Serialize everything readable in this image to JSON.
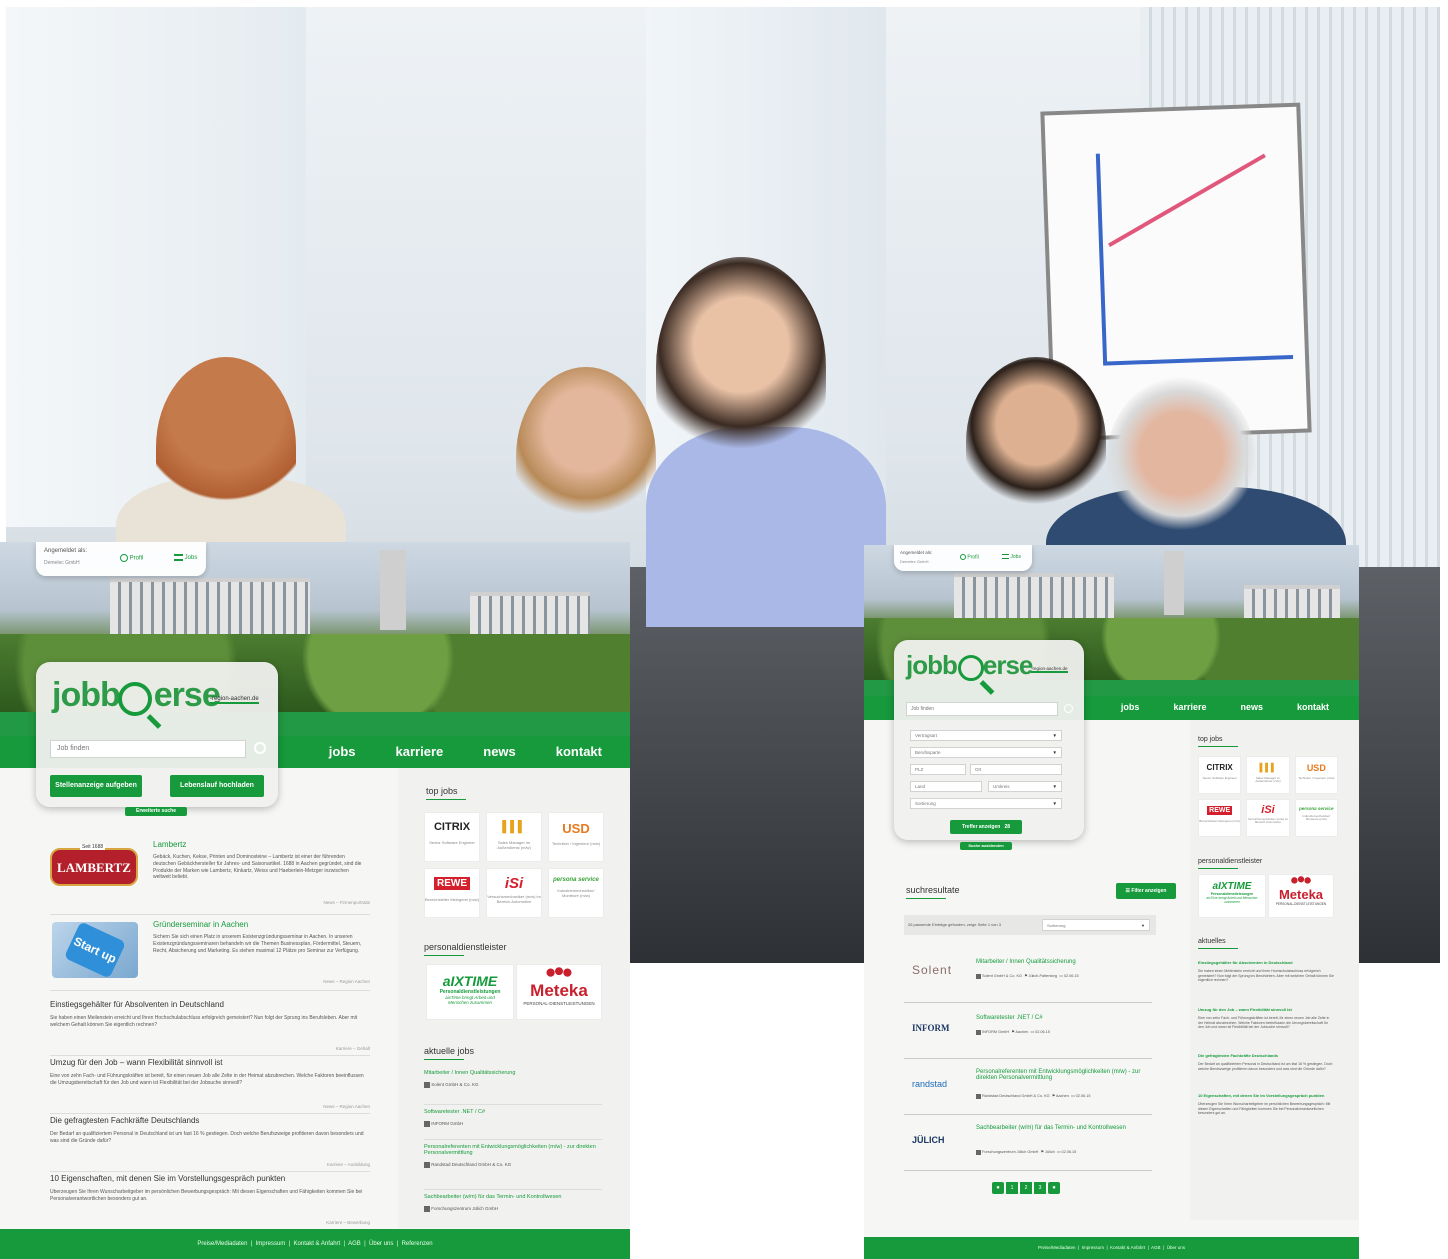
{
  "left": {
    "login": {
      "label": "Angemeldet als:",
      "company": "Demelec GmbH",
      "profil": "Profil",
      "jobs": "Jobs"
    },
    "logo": {
      "word": "jobb",
      "word2": "erse",
      "domain": "-region-aachen.de"
    },
    "search_placeholder": "Job finden",
    "nav": [
      "jobs",
      "karriere",
      "news",
      "kontakt"
    ],
    "buttons": {
      "post": "Stellenanzeige aufgeben",
      "cv": "Lebenslauf hochladen",
      "advanced": "Erweiterte suche"
    },
    "articles": [
      {
        "title": "Lambertz",
        "text": "Gebäck, Kuchen, Kekse, Printen und Dominosteine – Lambertz ist einer der führenden deutschen Gebäckhersteller für Jahres- und Saisonartikel. 1688 in Aachen gegründet, sind die Produkte der Marken wie Lambertz, Kinkartz, Weiss und Haeberlein-Metzger inzwischen weltweit beliebt.",
        "tag": "News – Firmenportraits",
        "logo": "LAMBERTZ",
        "logo_sub": "Seit 1688"
      },
      {
        "title": "Gründerseminar in Aachen",
        "text": "Sichern Sie sich einen Platz in unserem Existenzgründungsseminar in Aachen. In unseren Existenzgründungsseminaren behandeln wir die Themen Businessplan, Fördermittel, Steuern, Recht, Absicherung und Marketing. Es stehen maximal 12 Plätze pro Seminar zur Verfügung.",
        "tag": "News – Region Aachen",
        "logo": "Start up"
      }
    ],
    "news": [
      {
        "title": "Einstiegsgehälter für Absolventen in Deutschland",
        "text": "Sie haben einen Meilenstein erreicht und Ihren Hochschulabschluss erfolgreich gemeistert? Nun folgt der Sprung ins Berufsleben. Aber mit welchem Gehalt können Sie eigentlich rechnen?",
        "tag": "Karriere – Gehalt"
      },
      {
        "title": "Umzug für den Job – wann Flexibilität sinnvoll ist",
        "text": "Eine von zehn Fach- und Führungskräften ist bereit, für einen neuen Job alle Zelte in der Heimat abzubrechen. Welche Faktoren beeinflussen die Umzugsbereitschaft für den Job und wann ist Flexibilität bei der Jobsuche sinnvoll?",
        "tag": "News – Region Aachen"
      },
      {
        "title": "Die gefragtesten Fachkräfte Deutschlands",
        "text": "Der Bedarf an qualifiziertem Personal in Deutschland ist um fast 16 % gestiegen. Doch welche Berufszweige profitieren davon besonders und was sind die Gründe dafür?",
        "tag": "Karriere – Ausbildung"
      },
      {
        "title": "10 Eigenschaften, mit denen Sie im Vorstellungsgespräch punkten",
        "text": "Überzeugen Sie Ihren Wunscharbeitgeber im persönlichen Bewerbungsgespräch: Mit diesen Eigenschaften und Fähigkeiten kommen Sie bei Personalverantwortlichen besonders gut an.",
        "tag": "Karriere – Bewerbung"
      }
    ],
    "top_jobs_title": "top jobs",
    "top_jobs": [
      {
        "brand": "CITRIX",
        "caption": "Senior Software Engineer",
        "color": "#222222"
      },
      {
        "brand": "▌▌▌",
        "caption": "Sales Manager im Außendienst (m/w)",
        "color": "#e8a21c"
      },
      {
        "brand": "USD",
        "caption": "Techniker / Ingenieur (m/w)",
        "color": "#e8791c"
      },
      {
        "brand": "REWE",
        "caption": "Bereichsleiter Metzgerei (m/w)",
        "color": "#d4202c"
      },
      {
        "brand": "iSi",
        "caption": "Versuchsmechaniker (m/w) im Bereich Automotive",
        "color": "#d4202c"
      },
      {
        "brand": "persona service",
        "caption": "Industriemechaniker/ Monteure (m/w)",
        "color": "#3aa33a"
      }
    ],
    "pd_title": "personaldienstleister",
    "pd": [
      {
        "brand": "aIXTIME",
        "sub": "Personaldienstleistungen",
        "sub2": "aixTime bringt Arbeit und Menschen zusammen"
      },
      {
        "brand": "Meteka",
        "sub": "PERSONAL-DIENSTLEISTUNGEN"
      }
    ],
    "aktuell_title": "aktuelle jobs",
    "aktuell": [
      {
        "title": "Mitarbeiter / Innen Qualitätssicherung",
        "company": "Solent GmbH & Co. KG"
      },
      {
        "title": "Softwaretester .NET / C#",
        "company": "INFORM GmbH"
      },
      {
        "title": "Personalreferenten mit Entwicklungsmöglichkeiten (m/w) - zur direkten Personalvermittlung",
        "company": "Randstad Deutschland GmbH & Co. KG"
      },
      {
        "title": "Sachbearbeiter (w/m) für das Termin- und Kontrollwesen",
        "company": "Forschungszentrum Jülich GmbH"
      }
    ],
    "footer": "Preise/Mediadaten  |  Impressum  |  Kontakt & Anfahrt  |  AGB  |  Über uns  |  Referenzen"
  },
  "right": {
    "login": {
      "label": "Angemeldet als:",
      "company": "Demelec GmbH",
      "profil": "Profil",
      "jobs": "Jobs"
    },
    "logo": {
      "word": "jobb",
      "word2": "erse",
      "domain": "-region-aachen.de"
    },
    "search_placeholder": "Job finden",
    "nav": [
      "jobs",
      "karriere",
      "news",
      "kontakt"
    ],
    "filters": {
      "vertragsart": "Vertragsart",
      "berufssparte": "Berufssparte",
      "plz": "PLZ",
      "ort": "Ort",
      "land": "Land",
      "umkreis": "Umkreis",
      "sortierung": "Sortierung"
    },
    "treffer": "Treffer anzeigen",
    "treffer_count": "28",
    "close": "Suche ausblenden",
    "results_title": "suchresultate",
    "filter_btn": "Filter anzeigen",
    "results_info": "26 passende Einträge gefunden, zeige Seite 1 von 3",
    "results_sort": "Sortierung",
    "results": [
      {
        "logo": "Solent",
        "title": "Mitarbeiter / Innen Qualitätssicherung",
        "company": "Solent GmbH & Co. KG",
        "place": "Jülich-Pattersbrg",
        "date": "02.06.15"
      },
      {
        "logo": "INFORM",
        "title": "Softwaretester .NET / C#",
        "company": "INFORM GmbH",
        "place": "Aachen",
        "date": "02.06.15"
      },
      {
        "logo": "randstad",
        "title": "Personalreferenten mit Entwicklungsmöglichkeiten (m/w) - zur direkten Personalvermittlung",
        "company": "Randstad Deutschland GmbH & Co. KG",
        "place": "Aachen",
        "date": "02.06.15"
      },
      {
        "logo": "JÜLICH",
        "title": "Sachbearbeiter (w/m) für das Termin- und Kontrollwesen",
        "company": "Forschungszentrum Jülich GmbH",
        "place": "Jülich",
        "date": "02.06.15"
      }
    ],
    "pages": [
      "1",
      "2",
      "3"
    ],
    "top_jobs_title": "top jobs",
    "top_jobs": [
      {
        "brand": "CITRIX",
        "caption": "Senior Software Engineer",
        "color": "#222222"
      },
      {
        "brand": "▌▌▌",
        "caption": "Sales Manager im Außendienst (m/w)",
        "color": "#e8a21c"
      },
      {
        "brand": "USD",
        "caption": "Techniker / Ingenieur (m/w)",
        "color": "#e8791c"
      },
      {
        "brand": "REWE",
        "caption": "Bereichsleiter Metzgerei (m/w)",
        "color": "#d4202c"
      },
      {
        "brand": "iSi",
        "caption": "Versuchsmechaniker (m/w) im Bereich Automotive",
        "color": "#d4202c"
      },
      {
        "brand": "persona service",
        "caption": "Industriemechaniker/ Monteure (m/w)",
        "color": "#3aa33a"
      }
    ],
    "pd_title": "personaldienstleister",
    "pd": [
      {
        "brand": "aIXTIME",
        "sub": "Personaldienstleistungen",
        "sub2": "aixTime bringt Arbeit und Menschen zusammen"
      },
      {
        "brand": "Meteka",
        "sub": "PERSONAL-DIENSTLEISTUNGEN"
      }
    ],
    "aktuell_title": "aktuelles",
    "aktuell": [
      {
        "title": "Einstiegsgehälter für Absolventen in Deutschland",
        "text": "Sie haben einen Meilenstein erreicht und Ihren Hochschulabschluss erfolgreich gemeistert? Nun folgt der Sprung ins Berufsleben. Aber mit welchem Gehalt können Sie eigentlich rechnen?"
      },
      {
        "title": "Umzug für den Job – wann Flexibilität sinnvoll ist",
        "text": "Eine von zehn Fach- und Führungskräften ist bereit, für einen neuen Job alle Zelte in der Heimat abzubrechen. Welche Faktoren beeinflussen die Umzugsbereitschaft für den Job und wann ist Flexibilität bei der Jobsuche sinnvoll?"
      },
      {
        "title": "Die gefragtesten Fachkräfte Deutschlands",
        "text": "Der Bedarf an qualifiziertem Personal in Deutschland ist um fast 16 % gestiegen. Doch welche Berufszweige profitieren davon besonders und was sind die Gründe dafür?"
      },
      {
        "title": "10 Eigenschaften, mit denen Sie im Vorstellungsgespräch punkten",
        "text": "Überzeugen Sie Ihren Wunscharbeitgeber im persönlichen Bewerbungsgespräch: Mit diesen Eigenschaften und Fähigkeiten kommen Sie bei Personalverantwortlichen besonders gut an."
      }
    ],
    "footer": "Preise/Mediadaten  |  Impressum  |  Kontakt & Anfahrt  |  AGB  |  Über uns"
  },
  "colors": {
    "brand_green": "#169a3c",
    "dark_green": "#0d8a33"
  }
}
